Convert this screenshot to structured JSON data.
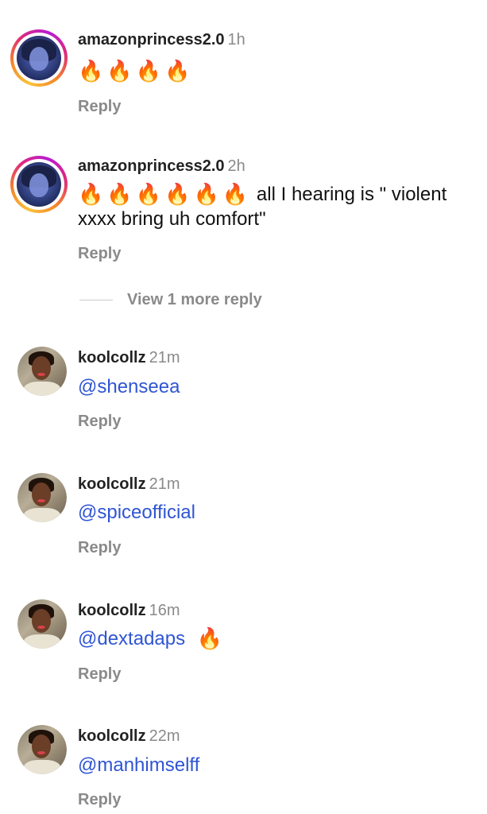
{
  "comments": [
    {
      "username": "amazonprincess2.0",
      "time": "1h",
      "fires": 4,
      "text": "",
      "reply_label": "Reply"
    },
    {
      "username": "amazonprincess2.0",
      "time": "2h",
      "fires": 6,
      "text": "all I hearing is \" violent xxxx bring uh comfort\"",
      "reply_label": "Reply"
    },
    {
      "username": "koolcollz",
      "time": "21m",
      "mention": "@shenseea",
      "reply_label": "Reply"
    },
    {
      "username": "koolcollz",
      "time": "21m",
      "mention": "@spiceofficial",
      "reply_label": "Reply"
    },
    {
      "username": "koolcollz",
      "time": "16m",
      "mention": "@dextadaps",
      "reply_label": "Reply"
    },
    {
      "username": "koolcollz",
      "time": "22m",
      "mention": "@manhimselff",
      "reply_label": "Reply"
    }
  ],
  "view_more_label": "View 1 more reply",
  "icons": {
    "fire": "fire-emoji",
    "avatar_story": "story-ring-avatar",
    "avatar_plain": "avatar"
  },
  "colors": {
    "mention": "#2f55d4",
    "secondary": "#8a8a8a",
    "fire": "#f2561d"
  }
}
